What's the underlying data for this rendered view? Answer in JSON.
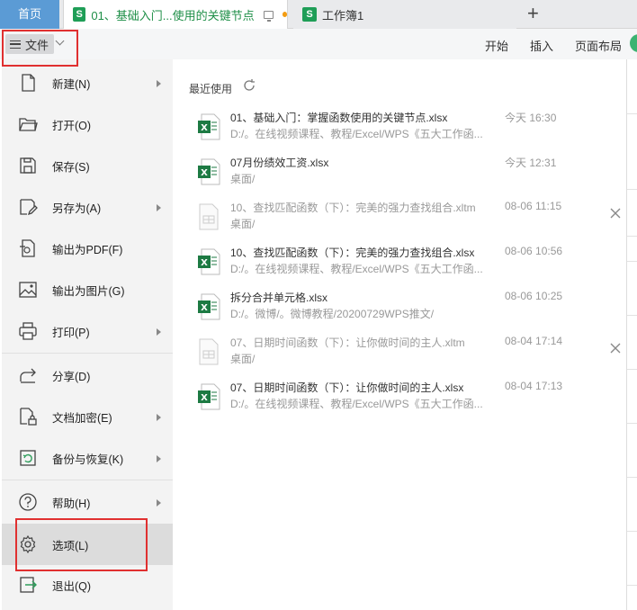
{
  "tabbar": {
    "home": "首页",
    "tabs": [
      {
        "label": "01、基础入门...使用的关键节点",
        "icon": "S"
      },
      {
        "label": "工作簿1",
        "icon": "S"
      }
    ],
    "new_tab": "+"
  },
  "toolbar": {
    "file_menu": "文件",
    "ribbon_tabs": [
      "开始",
      "插入",
      "页面布局"
    ]
  },
  "menu": [
    {
      "label": "新建(N)",
      "icon": "new-document-icon",
      "submenu": true
    },
    {
      "label": "打开(O)",
      "icon": "folder-open-icon",
      "submenu": false
    },
    {
      "label": "保存(S)",
      "icon": "save-icon",
      "submenu": false
    },
    {
      "label": "另存为(A)",
      "icon": "save-as-icon",
      "submenu": true
    },
    {
      "label": "输出为PDF(F)",
      "icon": "pdf-export-icon",
      "submenu": false
    },
    {
      "label": "输出为图片(G)",
      "icon": "image-export-icon",
      "submenu": false
    },
    {
      "label": "打印(P)",
      "icon": "printer-icon",
      "submenu": true
    },
    {
      "label": "分享(D)",
      "icon": "share-icon",
      "submenu": false
    },
    {
      "label": "文档加密(E)",
      "icon": "encrypt-icon",
      "submenu": true
    },
    {
      "label": "备份与恢复(K)",
      "icon": "backup-icon",
      "submenu": true
    },
    {
      "label": "帮助(H)",
      "icon": "help-icon",
      "submenu": true
    },
    {
      "label": "选项(L)",
      "icon": "gear-icon",
      "submenu": false
    },
    {
      "label": "退出(Q)",
      "icon": "exit-icon",
      "submenu": false
    }
  ],
  "recent": {
    "title": "最近使用",
    "files": [
      {
        "name": "01、基础入门：掌握函数使用的关键节点.xlsx",
        "path": "D:/。在线视频课程、教程/Excel/WPS《五大工作函...",
        "time": "今天 16:30",
        "type": "xlsx",
        "closable": false
      },
      {
        "name": "07月份绩效工资.xlsx",
        "path": "桌面/",
        "time": "今天 12:31",
        "type": "xlsx",
        "closable": false
      },
      {
        "name": "10、查找匹配函数（下）：完美的强力查找组合.xltm",
        "path": "桌面/",
        "time": "08-06 11:15",
        "type": "template",
        "closable": true
      },
      {
        "name": "10、查找匹配函数（下）：完美的强力查找组合.xlsx",
        "path": "D:/。在线视频课程、教程/Excel/WPS《五大工作函...",
        "time": "08-06 10:56",
        "type": "xlsx",
        "closable": false
      },
      {
        "name": "拆分合并单元格.xlsx",
        "path": "D:/。微博/。微博教程/20200729WPS推文/",
        "time": "08-06 10:25",
        "type": "xlsx",
        "closable": false
      },
      {
        "name": "07、日期时间函数（下）：让你做时间的主人.xltm",
        "path": "桌面/",
        "time": "08-04 17:14",
        "type": "template",
        "closable": true
      },
      {
        "name": "07、日期时间函数（下）：让你做时间的主人.xlsx",
        "path": "D:/。在线视频课程、教程/Excel/WPS《五大工作函...",
        "time": "08-04 17:13",
        "type": "xlsx",
        "closable": false
      }
    ]
  },
  "colors": {
    "accent_green": "#1f8f48",
    "highlight_red": "#e03030",
    "home_tab_blue": "#5b9bd5"
  }
}
